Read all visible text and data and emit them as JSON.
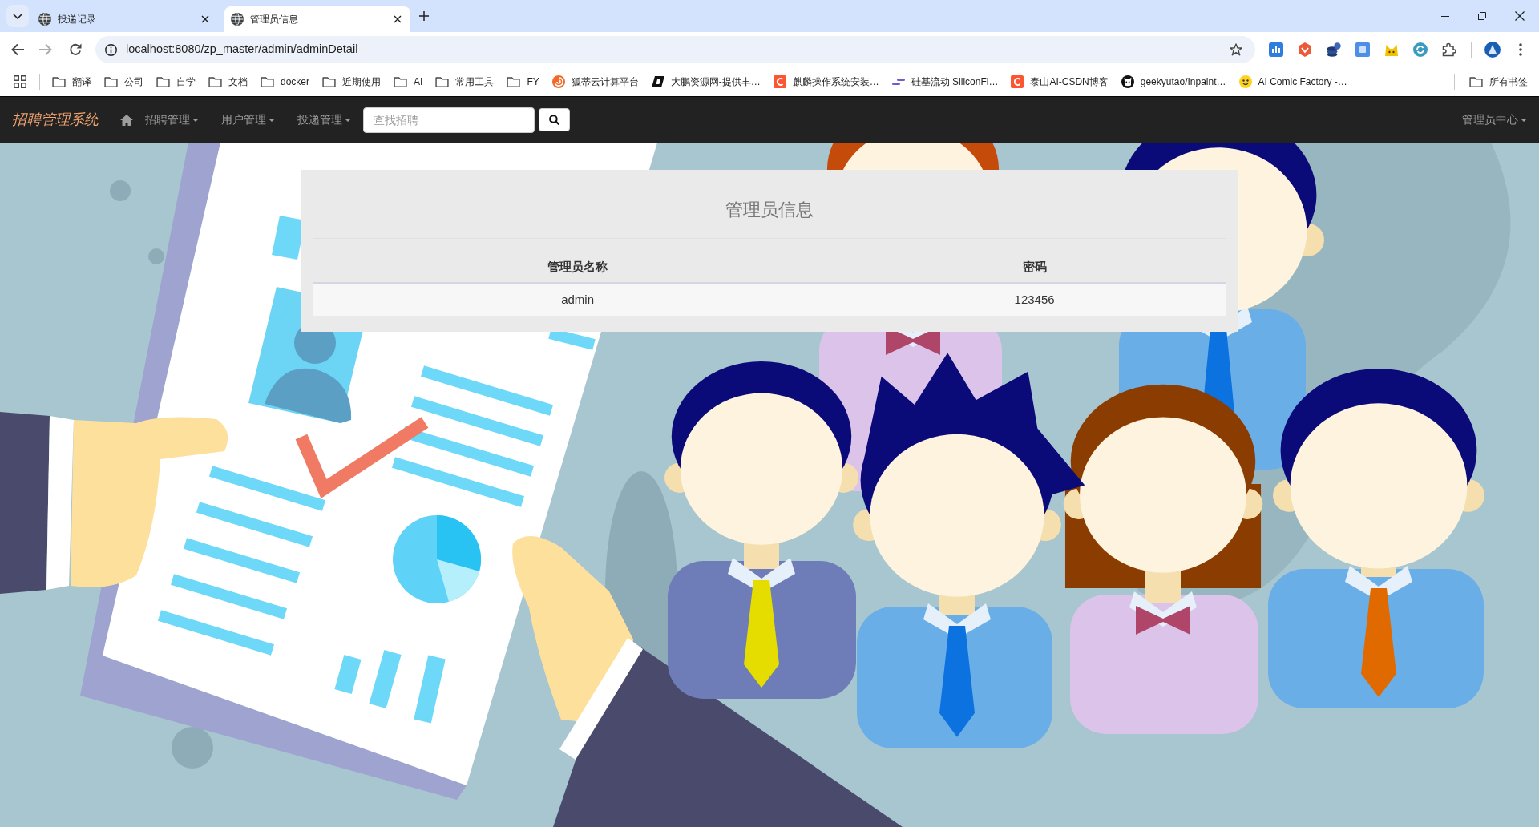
{
  "browser": {
    "tabs": [
      {
        "title": "投递记录",
        "selected": false
      },
      {
        "title": "管理员信息",
        "selected": true
      }
    ],
    "address_bar": {
      "url": "localhost:8080/zp_master/admin/adminDetail"
    },
    "bookmarks": [
      {
        "label": "翻译",
        "kind": "folder"
      },
      {
        "label": "公司",
        "kind": "folder"
      },
      {
        "label": "自学",
        "kind": "folder"
      },
      {
        "label": "文档",
        "kind": "folder"
      },
      {
        "label": "docker",
        "kind": "folder"
      },
      {
        "label": "近期使用",
        "kind": "folder"
      },
      {
        "label": "AI",
        "kind": "folder"
      },
      {
        "label": "常用工具",
        "kind": "folder"
      },
      {
        "label": "FY",
        "kind": "folder"
      },
      {
        "label": "狐蒂云计算平台",
        "kind": "site"
      },
      {
        "label": "大鹏资源网-提供丰…",
        "kind": "site"
      },
      {
        "label": "麒麟操作系统安装…",
        "kind": "site"
      },
      {
        "label": "硅基流动 SiliconFl…",
        "kind": "site"
      },
      {
        "label": "泰山AI-CSDN博客",
        "kind": "site"
      },
      {
        "label": "geekyutao/Inpaint…",
        "kind": "site"
      },
      {
        "label": "AI Comic Factory -…",
        "kind": "site"
      }
    ],
    "all_bookmarks": {
      "label": "所有书签"
    }
  },
  "navbar": {
    "brand": "招聘管理系统",
    "menus": [
      {
        "label": "招聘管理"
      },
      {
        "label": "用户管理"
      },
      {
        "label": "投递管理"
      }
    ],
    "search": {
      "placeholder": "查找招聘"
    },
    "account_menu": {
      "label": "管理员中心"
    }
  },
  "panel": {
    "title": "管理员信息",
    "table": {
      "columns": [
        "管理员名称",
        "密码"
      ],
      "rows": [
        [
          "admin",
          "123456"
        ]
      ]
    }
  }
}
